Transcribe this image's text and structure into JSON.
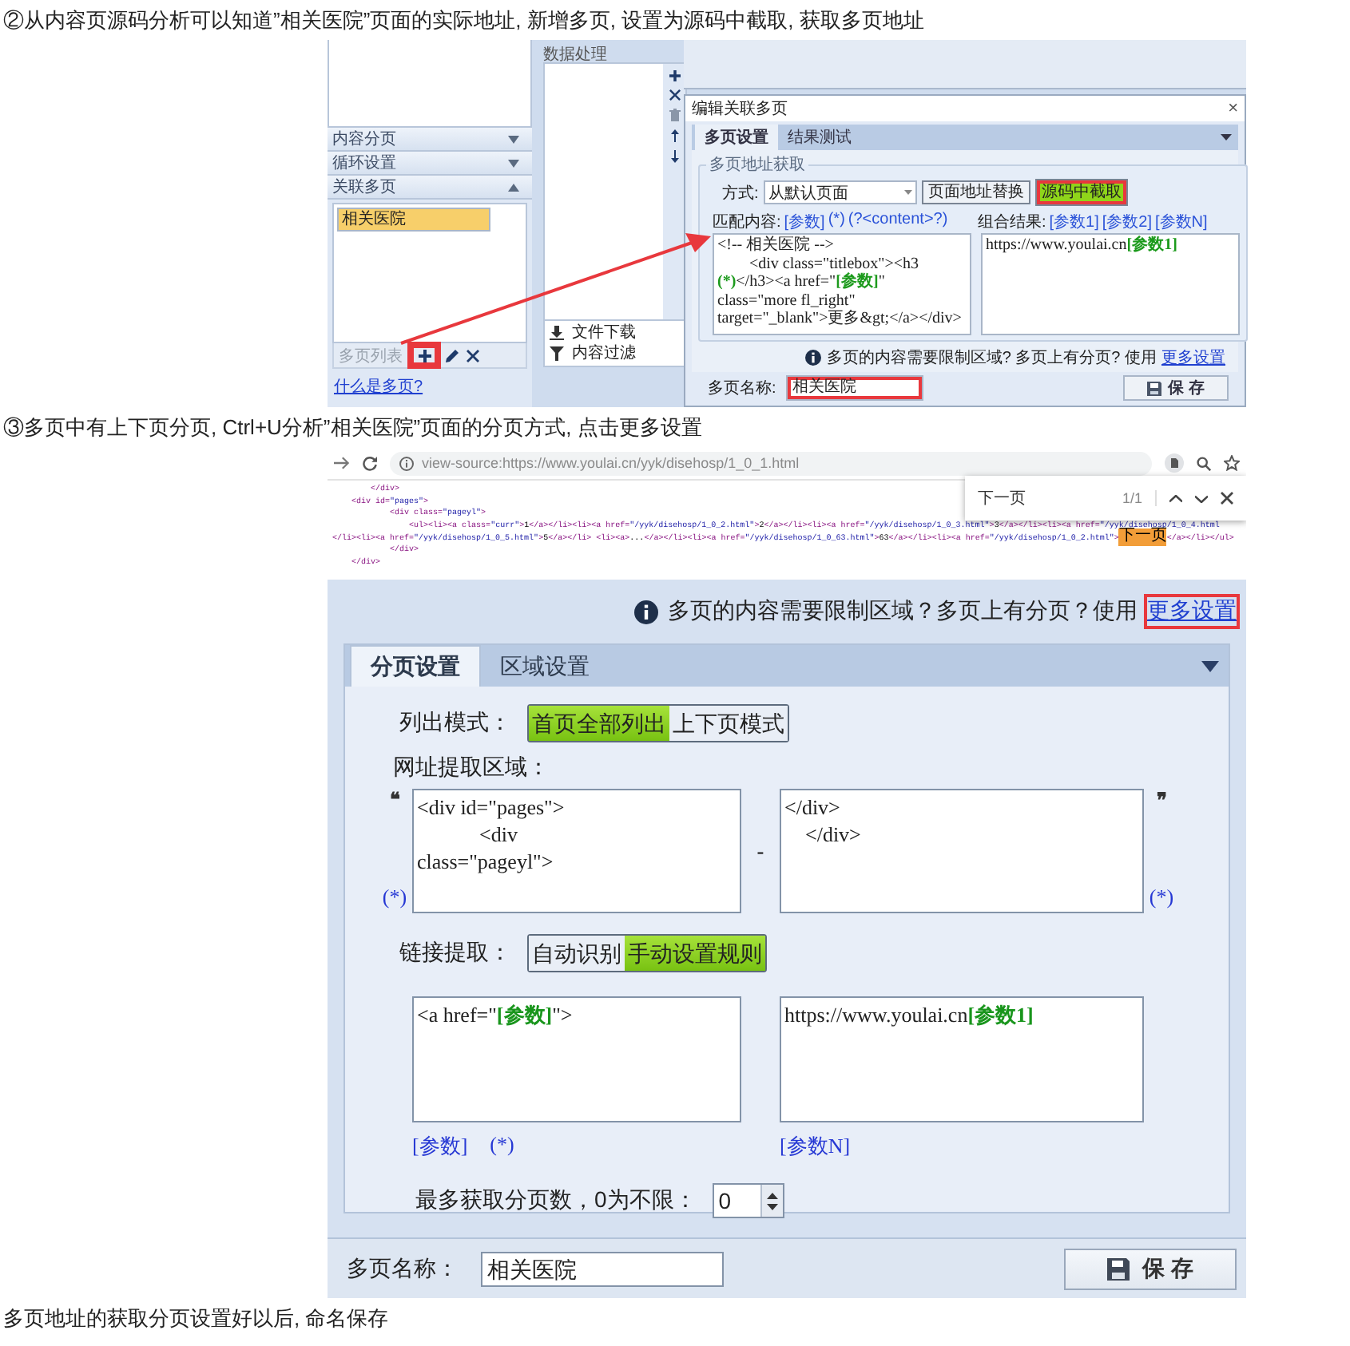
{
  "step_2": {
    "caption": "②从内容页源码分析可以知道”相关医院”页面的实际地址, 新增多页, 设置为源码中截取, 获取多页地址",
    "app_window": {
      "left_panel": {
        "sections": [
          {
            "label": "内容分页",
            "expanded": false
          },
          {
            "label": "循环设置",
            "expanded": false
          },
          {
            "label": "关联多页",
            "expanded": true
          }
        ],
        "pages": [
          {
            "label": "相关医院",
            "selected": true
          }
        ],
        "toolbar": {
          "label": "多页列表",
          "add_annotated": true
        },
        "help_link": "什么是多页?"
      },
      "processing_panel": {
        "title": "数据处理",
        "actions": [
          {
            "kind": "download",
            "label": "文件下载"
          },
          {
            "kind": "filter",
            "label": "内容过滤"
          }
        ]
      },
      "dialog": {
        "title": "编辑关联多页",
        "close": "×",
        "tabs": [
          {
            "label": "多页设置",
            "selected": true
          },
          {
            "label": "结果测试",
            "selected": false
          }
        ],
        "group_title": "多页地址获取",
        "method_label": "方式:",
        "method_value": "从默认页面",
        "method_buttons": [
          {
            "label": "页面地址替换",
            "selected": false,
            "annotated": false
          },
          {
            "label": "源码中截取",
            "selected": true,
            "annotated": true
          }
        ],
        "match_label": "匹配内容:",
        "match_tokens": [
          "[参数]",
          "(*)",
          "(?<content>?)"
        ],
        "result_label": "组合结果:",
        "result_tokens": [
          "[参数1]",
          "[参数2]",
          "[参数N]"
        ],
        "match_code": [
          [
            {
              "kind": "plain",
              "text": "<!-- 相关医院 -->"
            }
          ],
          [
            {
              "kind": "plain",
              "text": "        <div class=\"titlebox\"><h3"
            }
          ],
          [
            {
              "kind": "param",
              "text": "(*)"
            },
            {
              "kind": "plain",
              "text": "</h3><a href=\""
            },
            {
              "kind": "param",
              "text": "[参数]"
            },
            {
              "kind": "plain",
              "text": "\""
            }
          ],
          [
            {
              "kind": "plain",
              "text": "class=\"more fl_right\""
            }
          ],
          [
            {
              "kind": "plain",
              "text": "target=\"_blank\">更多&gt;</a></div>"
            }
          ]
        ],
        "result_code": [
          [
            {
              "kind": "plain",
              "text": "https://www.youlai.cn"
            },
            {
              "kind": "param",
              "text": "[参数1]"
            }
          ]
        ],
        "info_text": "多页的内容需要限制区域? 多页上有分页? 使用",
        "info_link": {
          "text": "更多设置",
          "annotated": false
        },
        "name_label": "多页名称:",
        "name_field": {
          "value": "相关医院",
          "annotated": true
        },
        "save_label": "保 存"
      }
    }
  },
  "step_3": {
    "caption": "③多页中有上下页分页, Ctrl+U分析”相关医院”页面的分页方式, 点击更多设置",
    "browser": {
      "address": "view-source:https://www.youlai.cn/yyk/disehosp/1_0_1.html",
      "find": {
        "query": "下一页",
        "count": "1/1"
      },
      "source_lines": [
        [
          {
            "text": "        </div>",
            "highlighted": false
          }
        ],
        [
          {
            "text": "    <div id=\"pages\">",
            "highlighted": false
          }
        ],
        [
          {
            "text": "            <div class=\"pageyl\">",
            "highlighted": false
          }
        ],
        [
          {
            "text": "                <ul><li><a class=\"curr\">1</a></li><li><a href=\"/yyk/disehosp/1_0_2.html\">2</a></li><li><a href=\"/yyk/disehosp/1_0_3.html\">3</a></li><li><a href=\"/yyk/disehosp/1_0_4.html",
            "highlighted": false
          }
        ],
        [
          {
            "text": "</li><li><a href=\"/yyk/disehosp/1_0_5.html\">5</a></li> <li><a>...</a></li><li><a href=\"/yyk/disehosp/1_0_63.html\">63</a></li><li><a href=\"/yyk/disehosp/1_0_2.html\">",
            "highlighted": false
          },
          {
            "text": "下一页",
            "highlighted": true
          },
          {
            "text": "</a></li></ul>",
            "highlighted": false
          }
        ],
        [
          {
            "text": "            </div>",
            "highlighted": false
          }
        ],
        [
          {
            "text": "    </div>",
            "highlighted": false
          }
        ]
      ]
    },
    "multipage_settings": {
      "info_text": "多页的内容需要限制区域？多页上有分页？使用",
      "info_link": {
        "text": "更多设置",
        "annotated": true
      },
      "tabs": [
        {
          "label": "分页设置",
          "selected": true
        },
        {
          "label": "区域设置",
          "selected": false
        }
      ],
      "list_mode": {
        "label": "列出模式：",
        "options": [
          {
            "label": "首页全部列出",
            "selected": true
          },
          {
            "label": "上下页模式",
            "selected": false
          }
        ]
      },
      "url_region": {
        "label": "网址提取区域：",
        "open_quote": "❝",
        "close_quote": "❞",
        "start_lines": [
          [
            {
              "kind": "plain",
              "text": "<div id=\"pages\">"
            }
          ],
          [
            {
              "kind": "plain",
              "text": "            <div"
            }
          ],
          [
            {
              "kind": "plain",
              "text": "class=\"pageyl\">"
            }
          ]
        ],
        "separator": "-",
        "end_lines": [
          [
            {
              "kind": "plain",
              "text": "</div>"
            }
          ],
          [
            {
              "kind": "plain",
              "text": "    </div>"
            }
          ]
        ],
        "start_wildcard": "(*)",
        "end_wildcard": "(*)"
      },
      "link_extract": {
        "label": "链接提取：",
        "options": [
          {
            "label": "自动识别",
            "selected": false
          },
          {
            "label": "手动设置规则",
            "selected": true
          }
        ],
        "match_lines": [
          [
            {
              "kind": "plain",
              "text": "<a href=\""
            },
            {
              "kind": "param",
              "text": "[参数]"
            },
            {
              "kind": "plain",
              "text": "\">"
            }
          ]
        ],
        "match_tokens": [
          "[参数]",
          "(*)"
        ],
        "result_lines": [
          [
            {
              "kind": "plain",
              "text": "https://www.youlai.cn"
            },
            {
              "kind": "param",
              "text": "[参数1]"
            }
          ]
        ],
        "result_tokens": [
          "[参数N]"
        ]
      },
      "max_pages": {
        "label": "最多获取分页数，0为不限：",
        "value": "0"
      },
      "name": {
        "label": "多页名称：",
        "value": "相关医院"
      },
      "save_label": "保 存"
    }
  },
  "closing_text": "多页地址的获取分页设置好以后, 命名保存"
}
